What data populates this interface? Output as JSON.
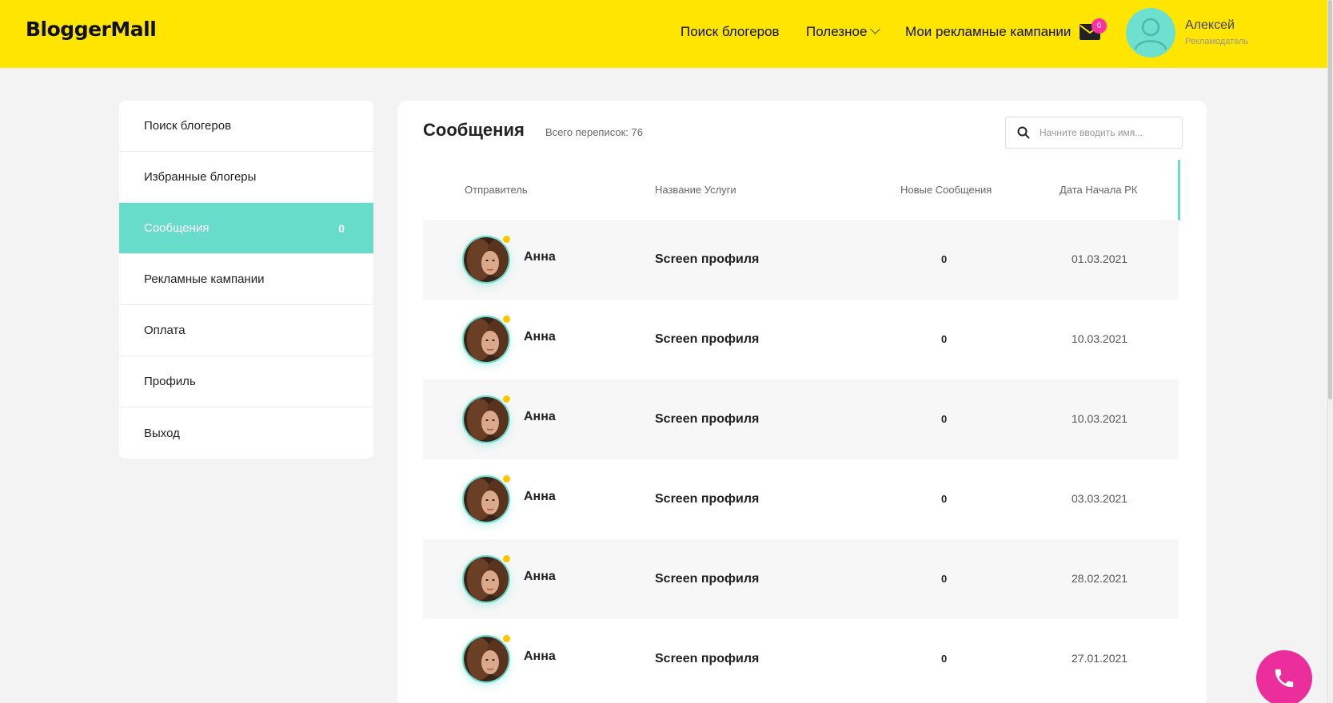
{
  "header": {
    "logo": "BloggerMall",
    "nav": {
      "search_bloggers": "Поиск блогеров",
      "useful": "Полезное",
      "my_campaigns": "Мои рекламные кампании"
    },
    "mail_count": "0",
    "user": {
      "name": "Алексей",
      "role": "Рекламодатель"
    }
  },
  "sidebar": {
    "items": [
      {
        "label": "Поиск блогеров"
      },
      {
        "label": "Избранные блогеры"
      },
      {
        "label": "Сообщения",
        "count": "0"
      },
      {
        "label": "Рекламные кампании"
      },
      {
        "label": "Оплата"
      },
      {
        "label": "Профиль"
      },
      {
        "label": "Выход"
      }
    ]
  },
  "main": {
    "title": "Сообщения",
    "total": "Всего переписок: 76",
    "search_placeholder": "Начните вводить имя..."
  },
  "table": {
    "headers": {
      "sender": "Отправитель",
      "service": "Название Услуги",
      "new_messages": "Новые Сообщения",
      "start_date": "Дата Начала РК"
    },
    "rows": [
      {
        "name": "Анна",
        "service": "Screen профиля",
        "new": "0",
        "date": "01.03.2021"
      },
      {
        "name": "Анна",
        "service": "Screen профиля",
        "new": "0",
        "date": "10.03.2021"
      },
      {
        "name": "Анна",
        "service": "Screen профиля",
        "new": "0",
        "date": "10.03.2021"
      },
      {
        "name": "Анна",
        "service": "Screen профиля",
        "new": "0",
        "date": "03.03.2021"
      },
      {
        "name": "Анна",
        "service": "Screen профиля",
        "new": "0",
        "date": "28.02.2021"
      },
      {
        "name": "Анна",
        "service": "Screen профиля",
        "new": "0",
        "date": "27.01.2021"
      }
    ]
  },
  "colors": {
    "header_bg": "#ffe500",
    "accent": "#68dccb",
    "badge": "#ff2ea3",
    "status_dot": "#ffc600",
    "call_button": "#ec2d9c"
  },
  "icons": {
    "mail": "envelope-icon",
    "search": "search-icon",
    "call": "phone-icon",
    "user": "user-avatar-icon"
  }
}
